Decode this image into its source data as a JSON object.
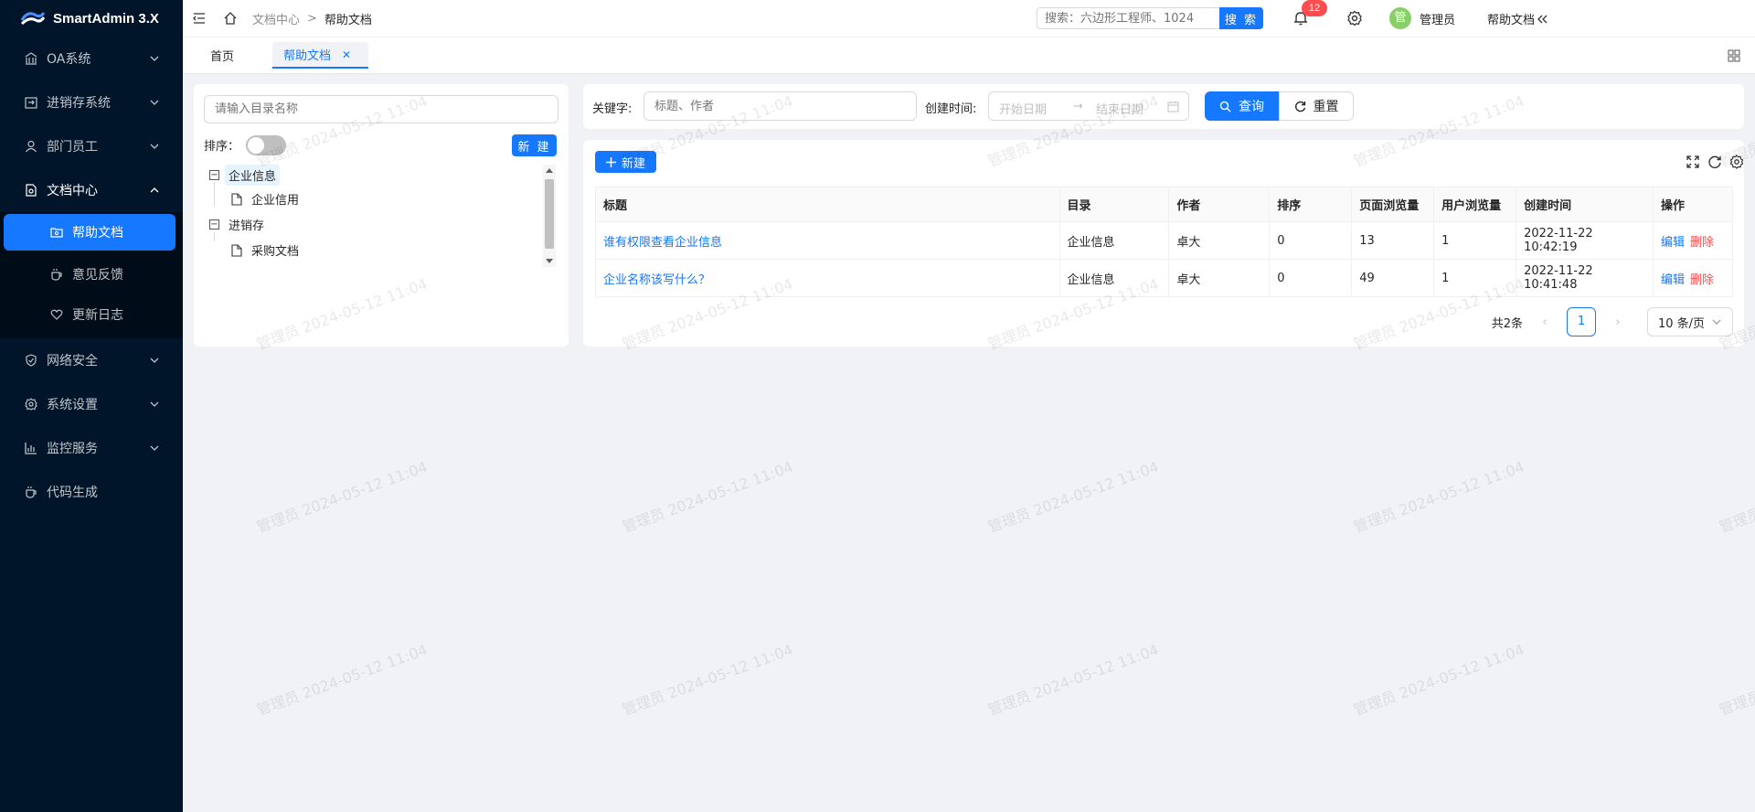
{
  "app": {
    "logo_text": "SmartAdmin 3.X"
  },
  "sidebar": {
    "items": [
      {
        "label": "OA系统",
        "icon": "bank-icon"
      },
      {
        "label": "进销存系统",
        "icon": "import-icon"
      },
      {
        "label": "部门员工",
        "icon": "user-icon"
      },
      {
        "label": "文档中心",
        "icon": "file-search-icon",
        "open": true
      },
      {
        "label": "网络安全",
        "icon": "safety-icon"
      },
      {
        "label": "系统设置",
        "icon": "setting-icon"
      },
      {
        "label": "监控服务",
        "icon": "bar-chart-icon"
      },
      {
        "label": "代码生成",
        "icon": "coffee-icon"
      }
    ],
    "doc_children": [
      {
        "label": "帮助文档",
        "icon": "folder-view-icon",
        "active": true
      },
      {
        "label": "意见反馈",
        "icon": "coffee-icon"
      },
      {
        "label": "更新日志",
        "icon": "heart-icon"
      }
    ]
  },
  "header": {
    "breadcrumb": [
      "文档中心",
      ">",
      "帮助文档"
    ],
    "search_placeholder": "搜索：六边形工程师、1024",
    "search_button": "搜 索",
    "notification_count": "12",
    "avatar_text": "管",
    "user_name": "管理员",
    "help_doc_label": "帮助文档"
  },
  "tabs": [
    {
      "label": "首页",
      "active": false
    },
    {
      "label": "帮助文档",
      "active": true
    }
  ],
  "catalog": {
    "search_placeholder": "请输入目录名称",
    "sort_label": "排序：",
    "sort_enabled": false,
    "new_button": "新 建",
    "tree": [
      {
        "label": "企业信息",
        "expanded": true,
        "children": [
          "企业信用"
        ]
      },
      {
        "label": "进销存",
        "expanded": true,
        "children": [
          "采购文档"
        ]
      }
    ]
  },
  "query": {
    "keyword_label": "关键字:",
    "keyword_placeholder": "标题、作者",
    "created_label": "创建时间:",
    "start_placeholder": "开始日期",
    "range_separator": "→",
    "end_placeholder": "结束日期",
    "query_button": "查询",
    "reset_button": "重置"
  },
  "table": {
    "add_button": "新建",
    "columns": [
      "标题",
      "目录",
      "作者",
      "排序",
      "页面浏览量",
      "用户浏览量",
      "创建时间",
      "操作"
    ],
    "rows": [
      {
        "title": "谁有权限查看企业信息",
        "catalog": "企业信息",
        "author": "卓大",
        "sort": "0",
        "page_views": "13",
        "user_views": "1",
        "created": "2022-11-22 10:42:19",
        "edit": "编辑",
        "delete": "删除"
      },
      {
        "title": "企业名称该写什么？",
        "catalog": "企业信息",
        "author": "卓大",
        "sort": "0",
        "page_views": "49",
        "user_views": "1",
        "created": "2022-11-22 10:41:48",
        "edit": "编辑",
        "delete": "删除"
      }
    ],
    "pagination": {
      "total": "共2条",
      "current": "1",
      "page_size": "10 条/页"
    }
  },
  "watermark": "管理员 2024-05-12 11:04",
  "colors": {
    "primary": "#1677ff",
    "danger": "#ff4d4f",
    "sidebar": "#001529"
  }
}
